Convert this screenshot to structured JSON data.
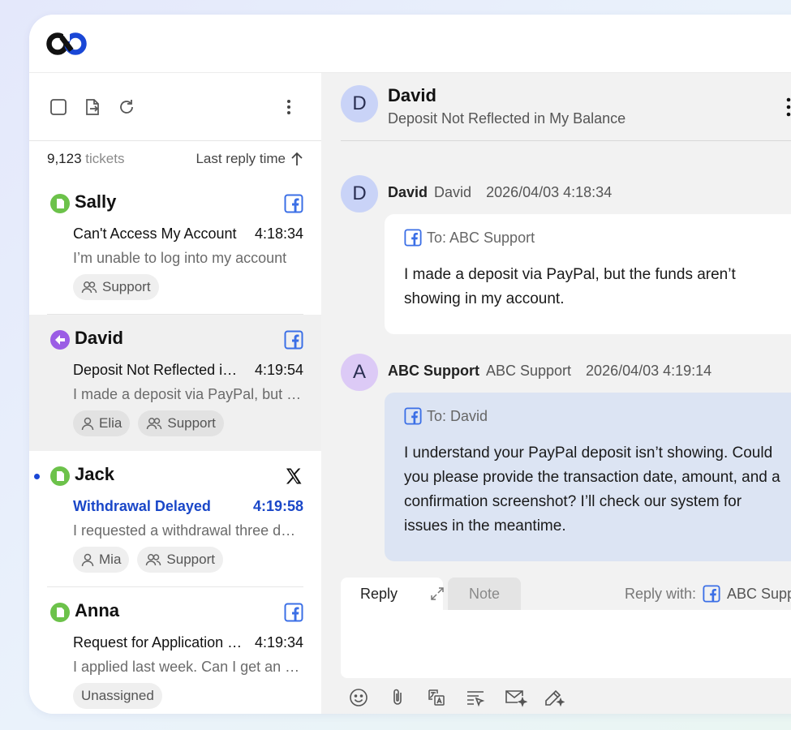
{
  "colors": {
    "accent": "#1a47c8",
    "facebook": "#3b6fe6",
    "status_green": "#6cc24a",
    "status_purple": "#9b5de5",
    "outgoing_bubble": "#dce4f3"
  },
  "ticket_list": {
    "count": "9,123",
    "count_unit": "tickets",
    "sort_label": "Last reply time",
    "tickets": [
      {
        "name": "Sally",
        "status_icon": "open-ticket-icon",
        "channel": "facebook-icon",
        "subject": "Can't Access My Account",
        "time": "4:18:34",
        "preview": "I’m unable to log into my account",
        "tags": [
          "Support"
        ],
        "unread": false,
        "selected": false
      },
      {
        "name": "David",
        "status_icon": "replied-ticket-icon",
        "channel": "facebook-icon",
        "subject": "Deposit Not Reflected in My Balance",
        "time": "4:19:54",
        "preview": "I made a deposit via PayPal, but the funds",
        "tags": [
          "Elia",
          "Support"
        ],
        "unread": false,
        "selected": true
      },
      {
        "name": "Jack",
        "status_icon": "open-ticket-icon",
        "channel": "x-icon",
        "subject": "Withdrawal Delayed",
        "time": "4:19:58",
        "preview": "I requested a withdrawal three days ago",
        "tags": [
          "Mia",
          "Support"
        ],
        "unread": true,
        "selected": false
      },
      {
        "name": "Anna",
        "status_icon": "open-ticket-icon",
        "channel": "facebook-icon",
        "subject": "Request for Application Status",
        "time": "4:19:34",
        "preview": "I applied last week. Can I get an update?",
        "tags": [
          "Unassigned"
        ],
        "unread": false,
        "selected": false
      }
    ]
  },
  "conversation": {
    "avatar": "D",
    "name": "David",
    "subject": "Deposit Not Reflected in My Balance",
    "messages": [
      {
        "avatar": "D",
        "sender": "David",
        "account": "David",
        "timestamp": "2026/04/03 4:18:34",
        "to": "To: ABC Support",
        "body": "I made a deposit via PayPal, but the funds aren’t showing in my account."
      },
      {
        "avatar": "A",
        "sender": "ABC Support",
        "account": "ABC Support",
        "timestamp": "2026/04/03 4:19:14",
        "to": "To: David",
        "body": "I understand your PayPal deposit isn’t showing. Could you please provide the transaction date, amount, and a confirmation screenshot? I’ll check our system for issues in the meantime."
      }
    ]
  },
  "reply": {
    "tab_reply": "Reply",
    "tab_note": "Note",
    "reply_with_label": "Reply with:",
    "reply_with_account": "ABC Support"
  }
}
